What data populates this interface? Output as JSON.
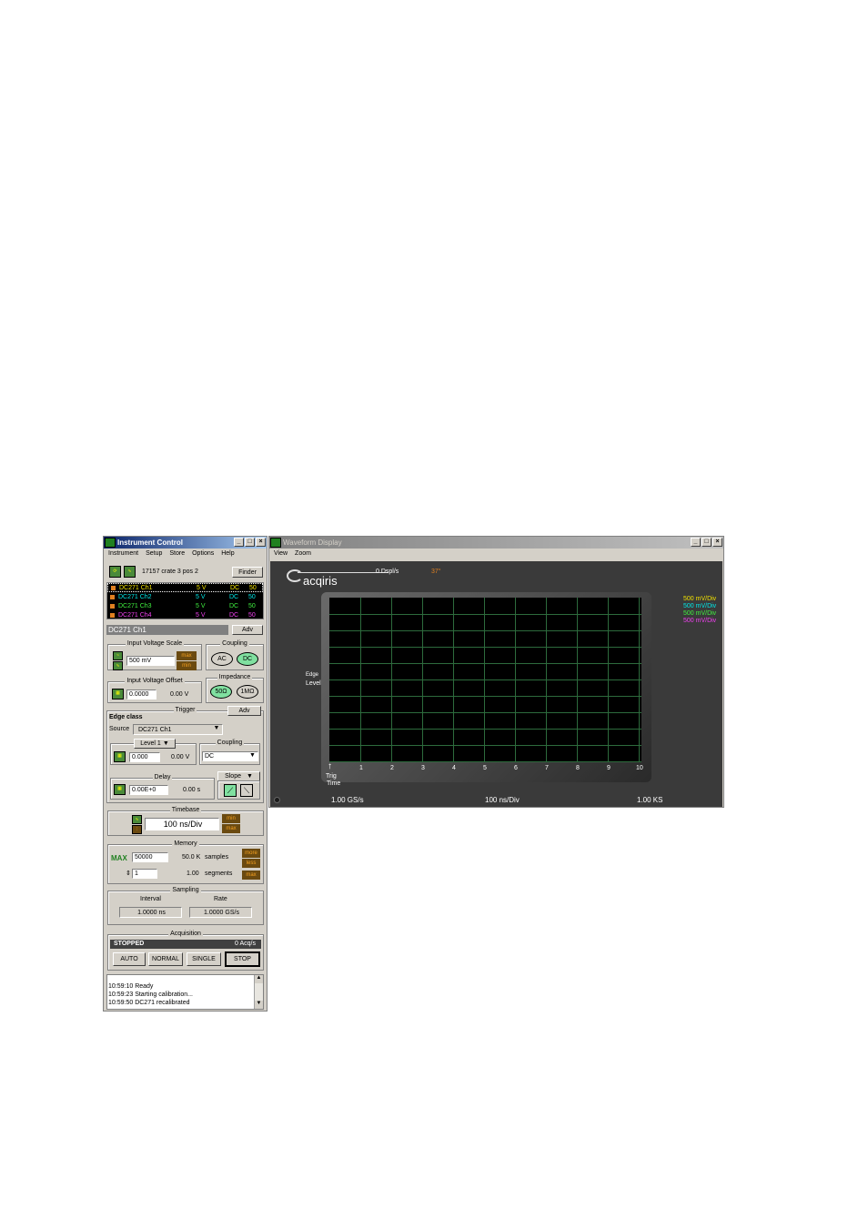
{
  "instrument_control": {
    "title": "Instrument Control",
    "menu": [
      "Instrument",
      "Setup",
      "Store",
      "Options",
      "Help"
    ],
    "device_text": "17157 crate 3 pos 2",
    "finder_label": "Finder",
    "channels": [
      {
        "name": "DC271 Ch1",
        "volts": "5 V",
        "coupling": "DC",
        "imp": "50",
        "color": "#f0e000",
        "selected": true
      },
      {
        "name": "DC271 Ch2",
        "volts": "5 V",
        "coupling": "DC",
        "imp": "50",
        "color": "#00e8e8"
      },
      {
        "name": "DC271 Ch3",
        "volts": "5 V",
        "coupling": "DC",
        "imp": "50",
        "color": "#40f040"
      },
      {
        "name": "DC271 Ch4",
        "volts": "5 V",
        "coupling": "DC",
        "imp": "50",
        "color": "#f040f0"
      }
    ],
    "selected_channel": "DC271 Ch1",
    "adv_label": "Adv",
    "input_voltage_scale": {
      "title": "Input Voltage Scale",
      "value": "500 mV",
      "max": "max",
      "min": "min"
    },
    "coupling": {
      "title": "Coupling",
      "ac": "AC",
      "dc": "DC"
    },
    "input_voltage_offset": {
      "title": "Input Voltage Offset",
      "value": "0.0000",
      "readout": "0.00 V"
    },
    "impedance": {
      "title": "Impedance",
      "opt1": "50Ω",
      "opt2": "1MΩ"
    },
    "trigger": {
      "title": "Trigger",
      "adv_label": "Adv",
      "class_label": "Edge class",
      "source_label": "Source",
      "source_value": "DC271 Ch1",
      "level_label": "Level 1",
      "level_value": "0.000",
      "level_readout": "0.00 V",
      "coupling_title": "Coupling",
      "coupling_value": "DC",
      "delay_title": "Delay",
      "delay_value": "0.00E+0",
      "delay_readout": "0.00 s",
      "slope_label": "Slope"
    },
    "timebase": {
      "title": "Timebase",
      "value": "100 ns/Div",
      "min": "min",
      "max": "max"
    },
    "memory": {
      "title": "Memory",
      "max_label": "MAX",
      "samples_value": "50000",
      "samples_readout": "50.0 K",
      "samples_label": "samples",
      "segments_value": "1",
      "segments_readout": "1.00",
      "segments_label": "segments",
      "more": "more",
      "less": "less",
      "max_btn": "max"
    },
    "sampling": {
      "title": "Sampling",
      "interval_label": "Interval",
      "rate_label": "Rate",
      "interval_value": "1.0000 ns",
      "rate_value": "1.0000 GS/s"
    },
    "acquisition": {
      "title": "Acquisition",
      "status": "STOPPED",
      "rate": "0 Acq/s",
      "buttons": [
        "AUTO",
        "NORMAL",
        "SINGLE",
        "STOP"
      ]
    },
    "log": [
      "10:59:10 Ready",
      "10:59:23 Starting calibration...",
      "10:59:50 DC271 recalibrated"
    ]
  },
  "waveform_display": {
    "title": "Waveform Display",
    "menu": [
      "View",
      "Zoom"
    ],
    "brand": "acqiris",
    "points_rate": "0 Dspl/s",
    "temperature": "37°",
    "scales": [
      {
        "text": "500 mV/Div",
        "color": "#f0e000"
      },
      {
        "text": "500 mV/Div",
        "color": "#00e8e8"
      },
      {
        "text": "500 mV/Div",
        "color": "#40f040"
      },
      {
        "text": "500 mV/Div",
        "color": "#f040f0"
      }
    ],
    "edge_label": "Edge",
    "level_label": "Level",
    "trig_label": "Trig",
    "time_label": "Time",
    "x_ticks": [
      "1",
      "2",
      "3",
      "4",
      "5",
      "6",
      "7",
      "8",
      "9",
      "10"
    ],
    "sample_rate": "1.00 GS/s",
    "time_div": "100 ns/Div",
    "record_length": "1.00 KS"
  }
}
